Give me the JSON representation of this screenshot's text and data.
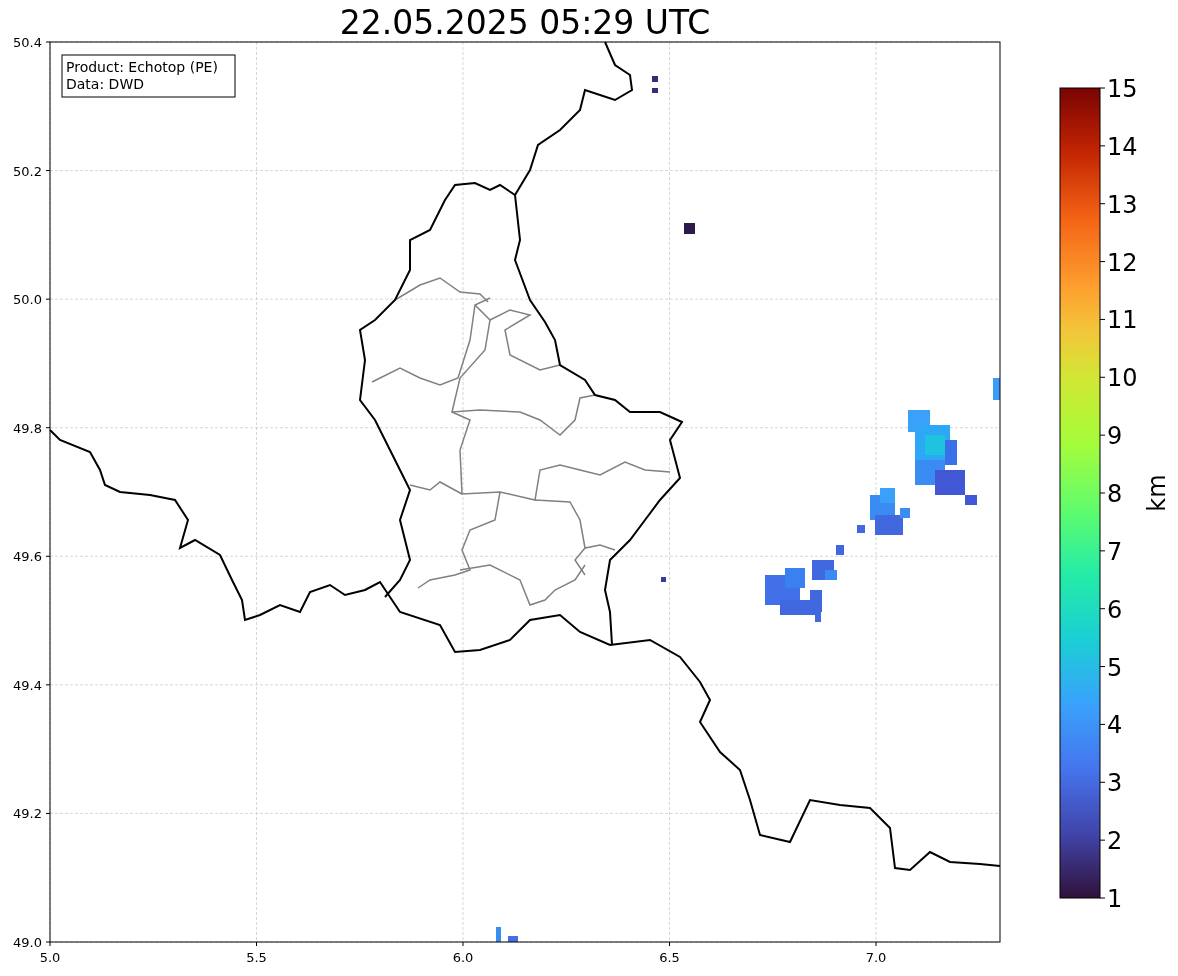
{
  "title": "22.05.2025 05:29 UTC",
  "info_box": {
    "lines": [
      "Product: Echotop (PE)",
      "Data: DWD"
    ]
  },
  "x_axis": {
    "ticks": [
      "5.0",
      "5.5",
      "6.0",
      "6.5",
      "7.0"
    ]
  },
  "y_axis": {
    "ticks": [
      "50.4",
      "50.2",
      "50.0",
      "49.8",
      "49.6",
      "49.4",
      "49.2",
      "49.0"
    ]
  },
  "colorbar": {
    "label": "km",
    "ticks": [
      "15",
      "14",
      "13",
      "12",
      "11",
      "10",
      "9",
      "8",
      "7",
      "6",
      "5",
      "4",
      "3",
      "2",
      "1"
    ]
  }
}
